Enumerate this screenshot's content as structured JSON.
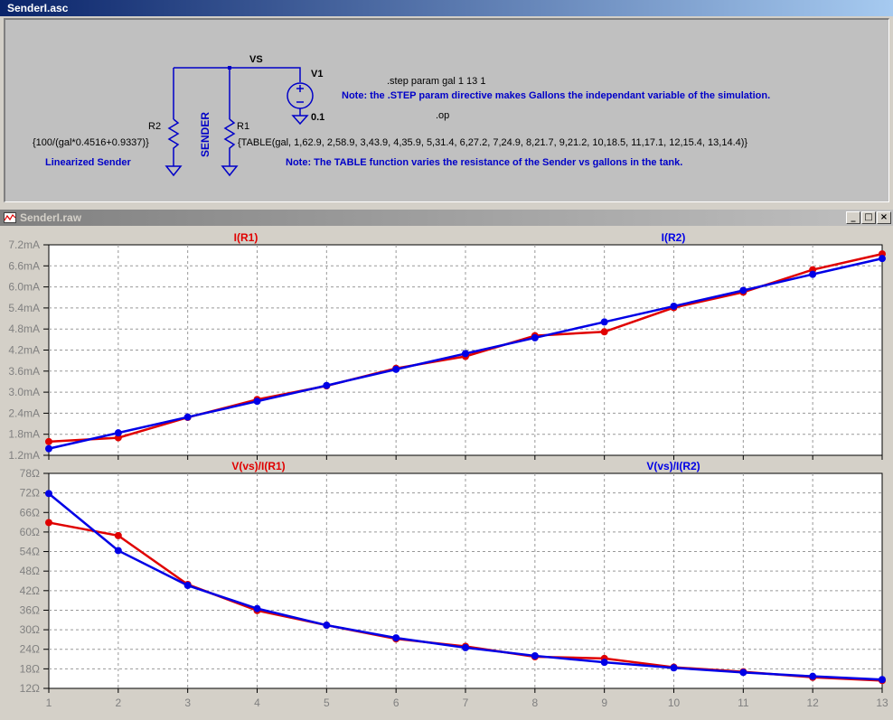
{
  "schematic": {
    "title": "SenderI.asc",
    "labels": {
      "vs": "VS",
      "v1": "V1",
      "v1_value": "0.1",
      "r2": "R2",
      "r1": "R1",
      "sender": "SENDER",
      "r2_formula": "{100/(gal*0.4516+0.9337)}",
      "r1_table": "{TABLE(gal,  1,62.9,  2,58.9,  3,43.9,  4,35.9,  5,31.4,  6,27.2,  7,24.9,  8,21.7,  9,21.2,  10,18.5,  11,17.1,  12,15.4,  13,14.4)}",
      "linearized": "Linearized Sender",
      "step": ".step param gal 1 13 1",
      "note_step": "Note: the .STEP param directive makes Gallons the independant variable of the simulation.",
      "op": ".op",
      "note_table": "Note: The TABLE function varies the resistance of the Sender vs gallons in the tank."
    }
  },
  "waveform": {
    "title": "SenderI.raw",
    "buttons": {
      "minimize": "_",
      "maximize": "□",
      "close": "×"
    }
  },
  "colors": {
    "red": "#e00000",
    "blue": "#0000e6"
  },
  "chart_data": [
    {
      "type": "line",
      "x": [
        1,
        2,
        3,
        4,
        5,
        6,
        7,
        8,
        9,
        10,
        11,
        12,
        13
      ],
      "ylim": [
        1.2,
        7.2
      ],
      "ytick_labels": [
        "7.2mA",
        "6.6mA",
        "6.0mA",
        "5.4mA",
        "4.8mA",
        "4.2mA",
        "3.6mA",
        "3.0mA",
        "2.4mA",
        "1.8mA",
        "1.2mA"
      ],
      "series": [
        {
          "name": "I(R1)",
          "color": "red",
          "values": [
            1.59,
            1.7,
            2.28,
            2.79,
            3.18,
            3.68,
            4.02,
            4.61,
            4.72,
            5.41,
            5.85,
            6.49,
            6.94
          ]
        },
        {
          "name": "I(R2)",
          "color": "blue",
          "values": [
            1.39,
            1.84,
            2.29,
            2.74,
            3.19,
            3.65,
            4.1,
            4.55,
            5.0,
            5.45,
            5.9,
            6.36,
            6.81
          ]
        }
      ]
    },
    {
      "type": "line",
      "x": [
        1,
        2,
        3,
        4,
        5,
        6,
        7,
        8,
        9,
        10,
        11,
        12,
        13
      ],
      "xtick_labels": [
        "1",
        "2",
        "3",
        "4",
        "5",
        "6",
        "7",
        "8",
        "9",
        "10",
        "11",
        "12",
        "13"
      ],
      "ylim": [
        12,
        78
      ],
      "ytick_labels": [
        "78Ω",
        "72Ω",
        "66Ω",
        "60Ω",
        "54Ω",
        "48Ω",
        "42Ω",
        "36Ω",
        "30Ω",
        "24Ω",
        "18Ω",
        "12Ω"
      ],
      "series": [
        {
          "name": "V(vs)/I(R1)",
          "color": "red",
          "values": [
            62.9,
            58.9,
            43.9,
            35.9,
            31.4,
            27.2,
            24.9,
            21.7,
            21.2,
            18.5,
            17.1,
            15.4,
            14.4
          ]
        },
        {
          "name": "V(vs)/I(R2)",
          "color": "blue",
          "values": [
            71.8,
            54.3,
            43.6,
            36.5,
            31.4,
            27.5,
            24.5,
            22.0,
            20.0,
            18.3,
            16.9,
            15.7,
            14.7
          ]
        }
      ]
    }
  ]
}
